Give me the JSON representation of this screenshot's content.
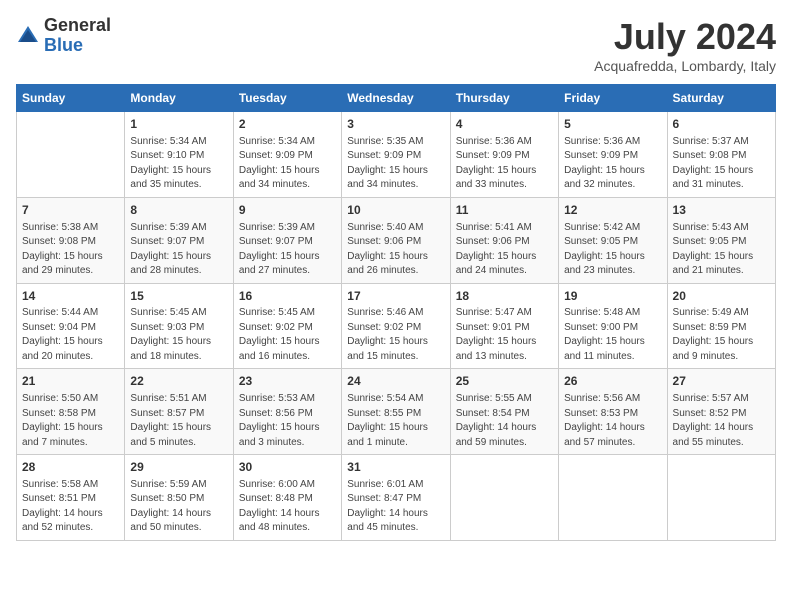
{
  "logo": {
    "general": "General",
    "blue": "Blue"
  },
  "title": "July 2024",
  "location": "Acquafredda, Lombardy, Italy",
  "days_of_week": [
    "Sunday",
    "Monday",
    "Tuesday",
    "Wednesday",
    "Thursday",
    "Friday",
    "Saturday"
  ],
  "weeks": [
    [
      {
        "day": "",
        "info": ""
      },
      {
        "day": "1",
        "info": "Sunrise: 5:34 AM\nSunset: 9:10 PM\nDaylight: 15 hours\nand 35 minutes."
      },
      {
        "day": "2",
        "info": "Sunrise: 5:34 AM\nSunset: 9:09 PM\nDaylight: 15 hours\nand 34 minutes."
      },
      {
        "day": "3",
        "info": "Sunrise: 5:35 AM\nSunset: 9:09 PM\nDaylight: 15 hours\nand 34 minutes."
      },
      {
        "day": "4",
        "info": "Sunrise: 5:36 AM\nSunset: 9:09 PM\nDaylight: 15 hours\nand 33 minutes."
      },
      {
        "day": "5",
        "info": "Sunrise: 5:36 AM\nSunset: 9:09 PM\nDaylight: 15 hours\nand 32 minutes."
      },
      {
        "day": "6",
        "info": "Sunrise: 5:37 AM\nSunset: 9:08 PM\nDaylight: 15 hours\nand 31 minutes."
      }
    ],
    [
      {
        "day": "7",
        "info": "Sunrise: 5:38 AM\nSunset: 9:08 PM\nDaylight: 15 hours\nand 29 minutes."
      },
      {
        "day": "8",
        "info": "Sunrise: 5:39 AM\nSunset: 9:07 PM\nDaylight: 15 hours\nand 28 minutes."
      },
      {
        "day": "9",
        "info": "Sunrise: 5:39 AM\nSunset: 9:07 PM\nDaylight: 15 hours\nand 27 minutes."
      },
      {
        "day": "10",
        "info": "Sunrise: 5:40 AM\nSunset: 9:06 PM\nDaylight: 15 hours\nand 26 minutes."
      },
      {
        "day": "11",
        "info": "Sunrise: 5:41 AM\nSunset: 9:06 PM\nDaylight: 15 hours\nand 24 minutes."
      },
      {
        "day": "12",
        "info": "Sunrise: 5:42 AM\nSunset: 9:05 PM\nDaylight: 15 hours\nand 23 minutes."
      },
      {
        "day": "13",
        "info": "Sunrise: 5:43 AM\nSunset: 9:05 PM\nDaylight: 15 hours\nand 21 minutes."
      }
    ],
    [
      {
        "day": "14",
        "info": "Sunrise: 5:44 AM\nSunset: 9:04 PM\nDaylight: 15 hours\nand 20 minutes."
      },
      {
        "day": "15",
        "info": "Sunrise: 5:45 AM\nSunset: 9:03 PM\nDaylight: 15 hours\nand 18 minutes."
      },
      {
        "day": "16",
        "info": "Sunrise: 5:45 AM\nSunset: 9:02 PM\nDaylight: 15 hours\nand 16 minutes."
      },
      {
        "day": "17",
        "info": "Sunrise: 5:46 AM\nSunset: 9:02 PM\nDaylight: 15 hours\nand 15 minutes."
      },
      {
        "day": "18",
        "info": "Sunrise: 5:47 AM\nSunset: 9:01 PM\nDaylight: 15 hours\nand 13 minutes."
      },
      {
        "day": "19",
        "info": "Sunrise: 5:48 AM\nSunset: 9:00 PM\nDaylight: 15 hours\nand 11 minutes."
      },
      {
        "day": "20",
        "info": "Sunrise: 5:49 AM\nSunset: 8:59 PM\nDaylight: 15 hours\nand 9 minutes."
      }
    ],
    [
      {
        "day": "21",
        "info": "Sunrise: 5:50 AM\nSunset: 8:58 PM\nDaylight: 15 hours\nand 7 minutes."
      },
      {
        "day": "22",
        "info": "Sunrise: 5:51 AM\nSunset: 8:57 PM\nDaylight: 15 hours\nand 5 minutes."
      },
      {
        "day": "23",
        "info": "Sunrise: 5:53 AM\nSunset: 8:56 PM\nDaylight: 15 hours\nand 3 minutes."
      },
      {
        "day": "24",
        "info": "Sunrise: 5:54 AM\nSunset: 8:55 PM\nDaylight: 15 hours\nand 1 minute."
      },
      {
        "day": "25",
        "info": "Sunrise: 5:55 AM\nSunset: 8:54 PM\nDaylight: 14 hours\nand 59 minutes."
      },
      {
        "day": "26",
        "info": "Sunrise: 5:56 AM\nSunset: 8:53 PM\nDaylight: 14 hours\nand 57 minutes."
      },
      {
        "day": "27",
        "info": "Sunrise: 5:57 AM\nSunset: 8:52 PM\nDaylight: 14 hours\nand 55 minutes."
      }
    ],
    [
      {
        "day": "28",
        "info": "Sunrise: 5:58 AM\nSunset: 8:51 PM\nDaylight: 14 hours\nand 52 minutes."
      },
      {
        "day": "29",
        "info": "Sunrise: 5:59 AM\nSunset: 8:50 PM\nDaylight: 14 hours\nand 50 minutes."
      },
      {
        "day": "30",
        "info": "Sunrise: 6:00 AM\nSunset: 8:48 PM\nDaylight: 14 hours\nand 48 minutes."
      },
      {
        "day": "31",
        "info": "Sunrise: 6:01 AM\nSunset: 8:47 PM\nDaylight: 14 hours\nand 45 minutes."
      },
      {
        "day": "",
        "info": ""
      },
      {
        "day": "",
        "info": ""
      },
      {
        "day": "",
        "info": ""
      }
    ]
  ]
}
